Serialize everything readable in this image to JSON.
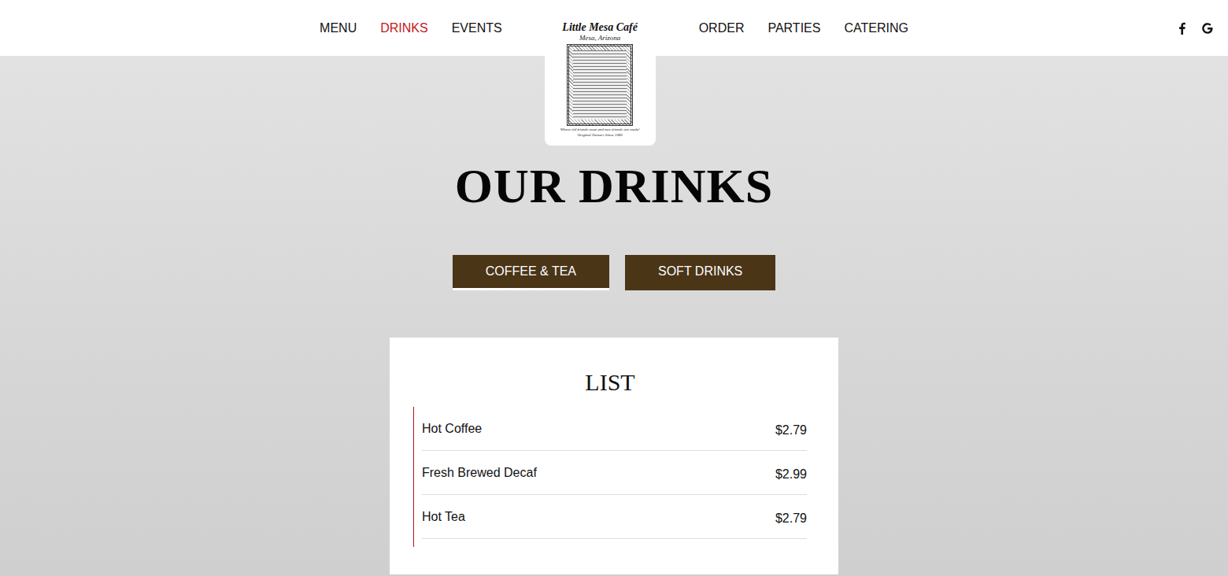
{
  "nav": {
    "left": [
      {
        "label": "MENU",
        "selected": false
      },
      {
        "label": "DRINKS",
        "selected": true
      },
      {
        "label": "EVENTS",
        "selected": false
      }
    ],
    "right": [
      {
        "label": "ORDER",
        "selected": false
      },
      {
        "label": "PARTIES",
        "selected": false
      },
      {
        "label": "CATERING",
        "selected": false
      }
    ]
  },
  "logo": {
    "name": "Little Mesa Café",
    "place": "Mesa, Arizona",
    "tagline": "Where old friends meet and new friends are made!",
    "since": "Original Owners Since 1989"
  },
  "title": "OUR DRINKS",
  "tabs": [
    {
      "label": "COFFEE & TEA",
      "selected": true
    },
    {
      "label": "SOFT DRINKS",
      "selected": false
    }
  ],
  "list": {
    "title": "LIST",
    "items": [
      {
        "name": "Hot Coffee",
        "price": "$2.79"
      },
      {
        "name": "Fresh Brewed Decaf",
        "price": "$2.99"
      },
      {
        "name": "Hot Tea",
        "price": "$2.79"
      }
    ]
  }
}
